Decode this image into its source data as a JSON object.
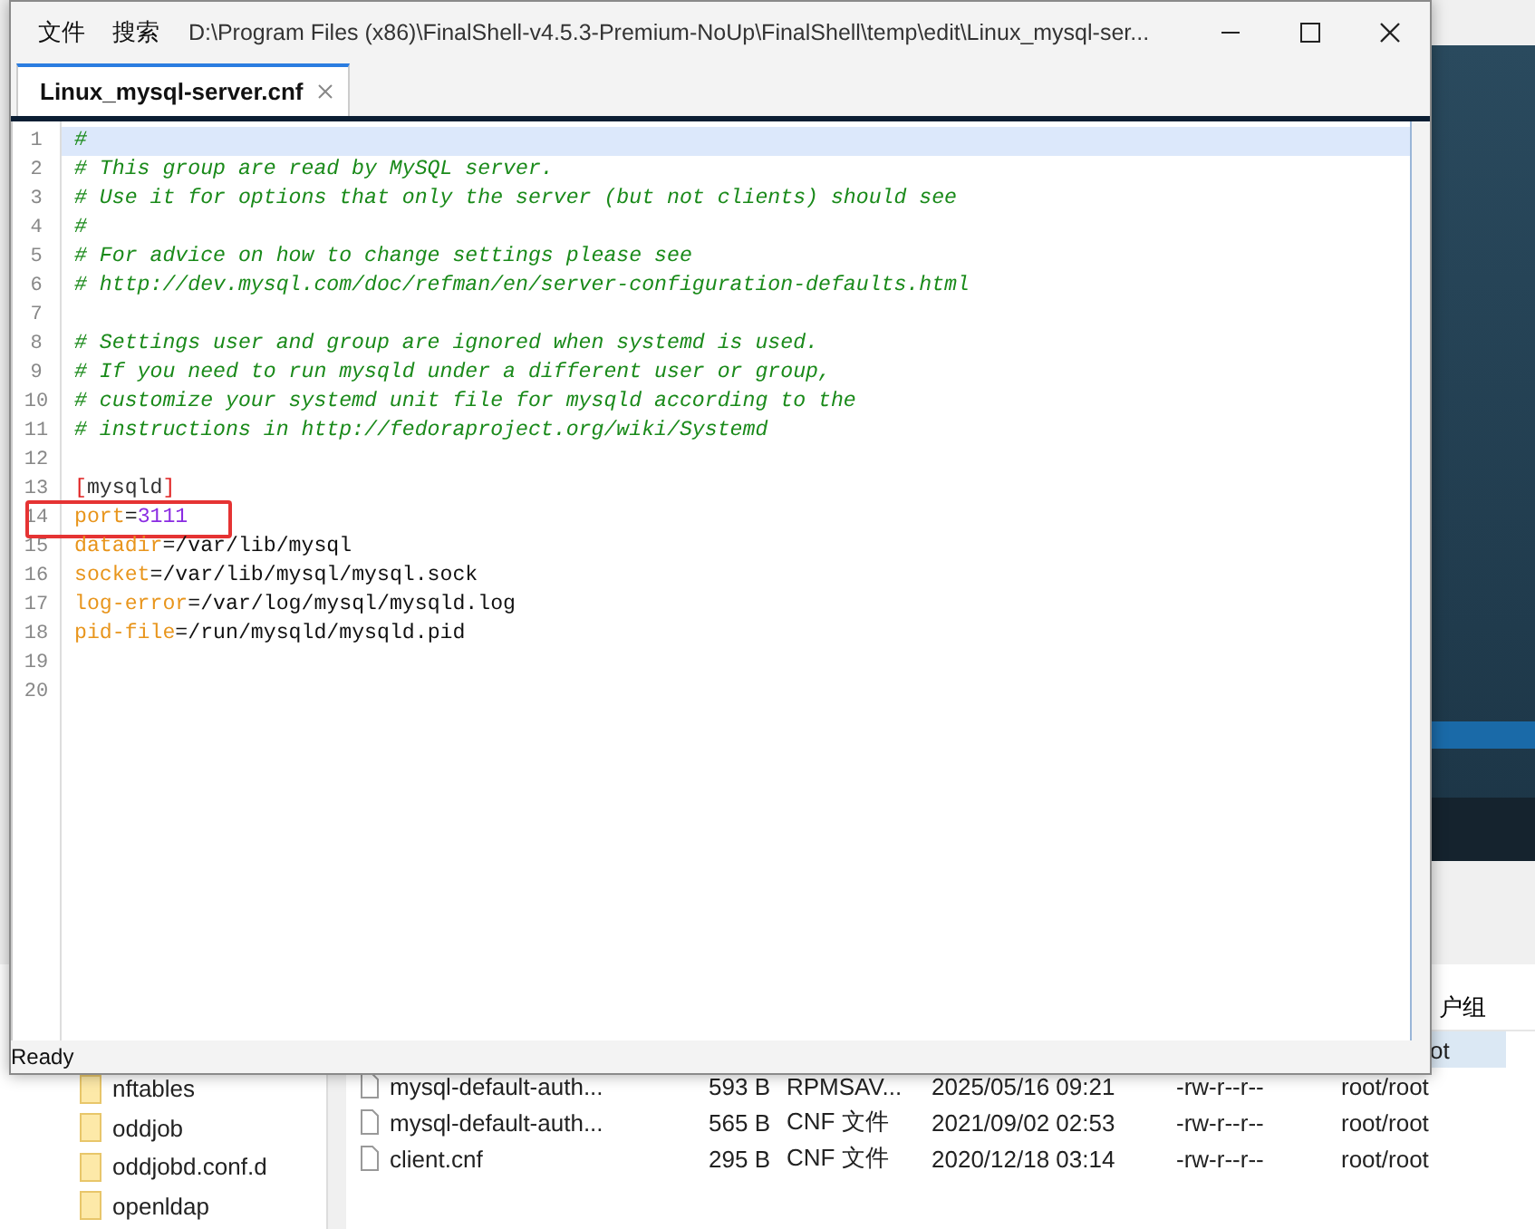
{
  "background_app": {
    "file_table": {
      "header_fragment": "户组",
      "rows": [
        {
          "name": "",
          "size": "",
          "type": "",
          "modified": "",
          "permissions": "",
          "owner": "ot",
          "selected": true
        },
        {
          "name": "mysql-default-auth...",
          "size": "593 B",
          "type": "RPMSAV...",
          "modified": "2025/05/16 09:21",
          "permissions": "-rw-r--r--",
          "owner": "root/root",
          "selected": false
        },
        {
          "name": "mysql-default-auth...",
          "size": "565 B",
          "type": "CNF 文件",
          "modified": "2021/09/02 02:53",
          "permissions": "-rw-r--r--",
          "owner": "root/root",
          "selected": false
        },
        {
          "name": "client.cnf",
          "size": "295 B",
          "type": "CNF 文件",
          "modified": "2020/12/18 03:14",
          "permissions": "-rw-r--r--",
          "owner": "root/root",
          "selected": false
        }
      ]
    },
    "folder_tree": [
      "nftables",
      "oddjob",
      "oddjobd.conf.d",
      "openldap"
    ]
  },
  "editor": {
    "menu": [
      "文件",
      "搜索"
    ],
    "title": "D:\\Program Files (x86)\\FinalShell-v4.5.3-Premium-NoUp\\FinalShell\\temp\\edit\\Linux_mysql-ser...",
    "tabs": [
      {
        "label": "Linux_mysql-server.cnf",
        "selected": true
      }
    ],
    "lines": [
      {
        "number": "1",
        "current": true,
        "marked": false,
        "tokens": [
          {
            "kind": "comment",
            "text": "#"
          }
        ]
      },
      {
        "number": "2",
        "current": false,
        "marked": false,
        "tokens": [
          {
            "kind": "comment",
            "text": "# This group are read by MySQL server."
          }
        ]
      },
      {
        "number": "3",
        "current": false,
        "marked": false,
        "tokens": [
          {
            "kind": "comment",
            "text": "# Use it for options that only the server (but not clients) should see"
          }
        ]
      },
      {
        "number": "4",
        "current": false,
        "marked": false,
        "tokens": [
          {
            "kind": "comment",
            "text": "#"
          }
        ]
      },
      {
        "number": "5",
        "current": false,
        "marked": false,
        "tokens": [
          {
            "kind": "comment",
            "text": "# For advice on how to change settings please see"
          }
        ]
      },
      {
        "number": "6",
        "current": false,
        "marked": false,
        "tokens": [
          {
            "kind": "comment",
            "text": "# http://dev.mysql.com/doc/refman/en/server-configuration-defaults.html"
          }
        ]
      },
      {
        "number": "7",
        "current": false,
        "marked": false
      },
      {
        "number": "8",
        "current": false,
        "marked": false,
        "tokens": [
          {
            "kind": "comment",
            "text": "# Settings user and group are ignored when systemd is used."
          }
        ]
      },
      {
        "number": "9",
        "current": false,
        "marked": false,
        "tokens": [
          {
            "kind": "comment",
            "text": "# If you need to run mysqld under a different user or group,"
          }
        ]
      },
      {
        "number": "10",
        "current": false,
        "marked": false,
        "tokens": [
          {
            "kind": "comment",
            "text": "# customize your systemd unit file for mysqld according to the"
          }
        ]
      },
      {
        "number": "11",
        "current": false,
        "marked": false,
        "tokens": [
          {
            "kind": "comment",
            "text": "# instructions in http://fedoraproject.org/wiki/Systemd"
          }
        ]
      },
      {
        "number": "12",
        "current": false,
        "marked": false
      },
      {
        "number": "13",
        "current": false,
        "marked": false,
        "tokens": [
          {
            "kind": "bracket",
            "text": "["
          },
          {
            "kind": "section",
            "text": "mysqld"
          },
          {
            "kind": "bracket",
            "text": "]"
          }
        ]
      },
      {
        "number": "14",
        "current": false,
        "marked": true,
        "tokens": [
          {
            "kind": "key",
            "text": "port"
          },
          {
            "kind": "value",
            "text": "="
          },
          {
            "kind": "number",
            "text": "3111"
          }
        ]
      },
      {
        "number": "15",
        "current": false,
        "marked": false,
        "tokens": [
          {
            "kind": "key",
            "text": "datadir"
          },
          {
            "kind": "value",
            "text": "=/var/lib/mysql"
          }
        ]
      },
      {
        "number": "16",
        "current": false,
        "marked": false,
        "tokens": [
          {
            "kind": "key",
            "text": "socket"
          },
          {
            "kind": "value",
            "text": "=/var/lib/mysql/mysql.sock"
          }
        ]
      },
      {
        "number": "17",
        "current": false,
        "marked": false,
        "tokens": [
          {
            "kind": "key",
            "text": "log-error"
          },
          {
            "kind": "value",
            "text": "=/var/log/mysql/mysqld.log"
          }
        ]
      },
      {
        "number": "18",
        "current": false,
        "marked": false,
        "tokens": [
          {
            "kind": "key",
            "text": "pid-file"
          },
          {
            "kind": "value",
            "text": "=/run/mysqld/mysqld.pid"
          }
        ]
      },
      {
        "number": "19",
        "current": false,
        "marked": false
      },
      {
        "number": "20",
        "current": false,
        "marked": false
      }
    ],
    "status": "Ready"
  }
}
